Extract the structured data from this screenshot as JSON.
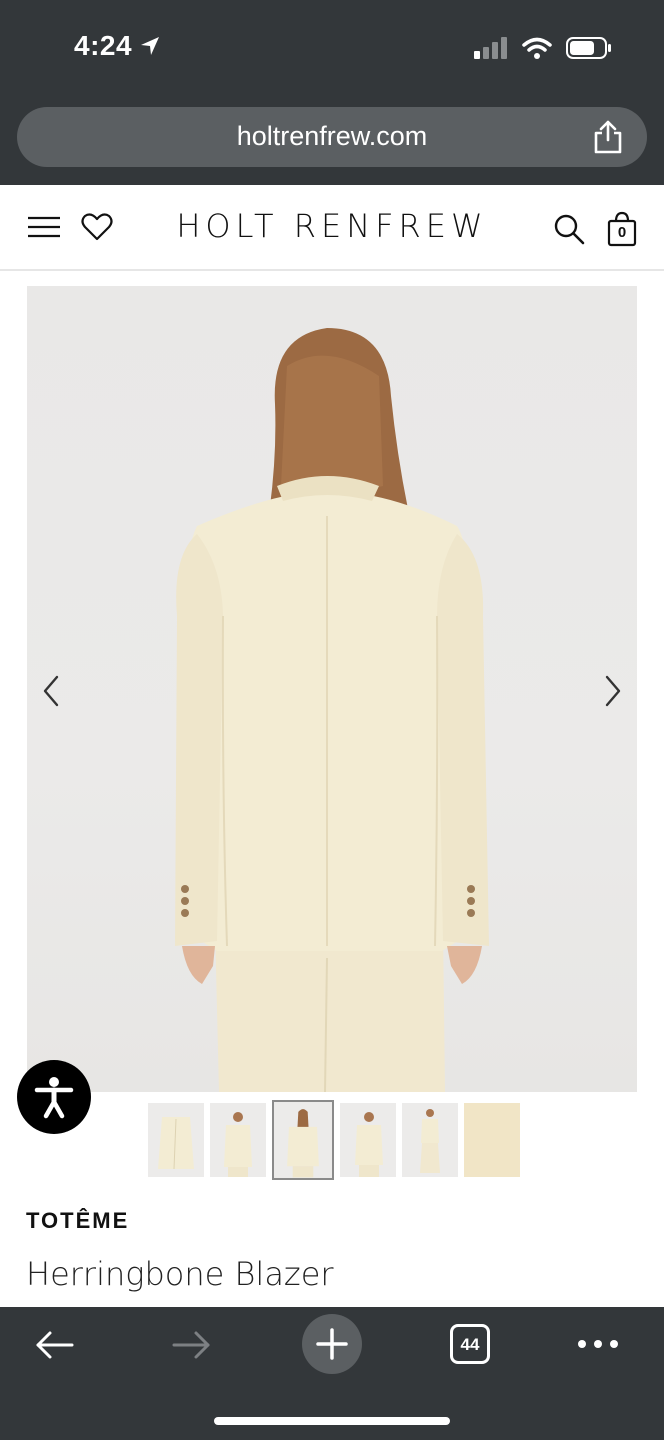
{
  "status_bar": {
    "time": "4:24"
  },
  "browser": {
    "url": "holtrenfrew.com",
    "tab_count": "44"
  },
  "site": {
    "logo": "HOLT RENFREW",
    "cart_count": "0"
  },
  "product": {
    "brand": "TOTÊME",
    "name": "Herringbone Blazer",
    "thumbnail_count": 6,
    "active_thumbnail": 3
  },
  "colors": {
    "browser_chrome": "#33373a",
    "url_bar": "#5b5f62",
    "blazer": "#f3ecd3",
    "image_background": "#e9e8e7"
  }
}
